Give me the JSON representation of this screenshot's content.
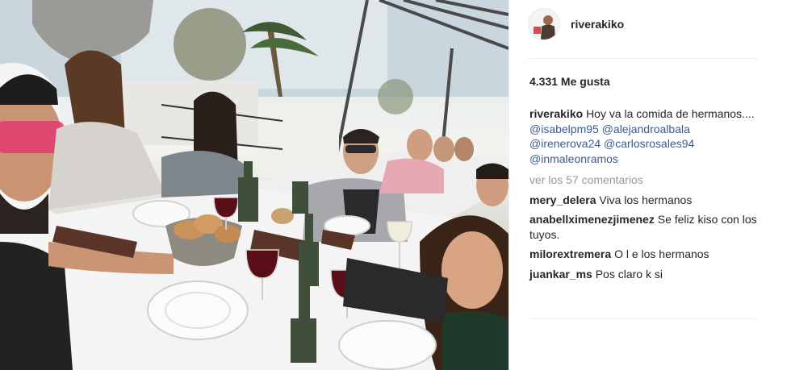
{
  "post": {
    "photo_description_icon": "photo-icon",
    "owner": {
      "username": "riverakiko",
      "avatar_icon": "profile-avatar-icon"
    },
    "likes_label": "4.331 Me gusta",
    "caption": {
      "username": "riverakiko",
      "text": "Hoy va la comida de hermanos....",
      "tags": [
        "@isabelpm95",
        "@alejandroalbala",
        "@irenerova24",
        "@carlosrosales94",
        "@inmaleonramos"
      ]
    },
    "view_all_comments": "ver los 57 comentarios",
    "comments": [
      {
        "username": "mery_delera",
        "text": "Viva los hermanos"
      },
      {
        "username": "anabellximenezjimenez",
        "text": "Se feliz kiso con los tuyos."
      },
      {
        "username": "milorextremera",
        "text": "O l e los hermanos"
      },
      {
        "username": "juankar_ms",
        "text": "Pos claro k si"
      }
    ]
  }
}
